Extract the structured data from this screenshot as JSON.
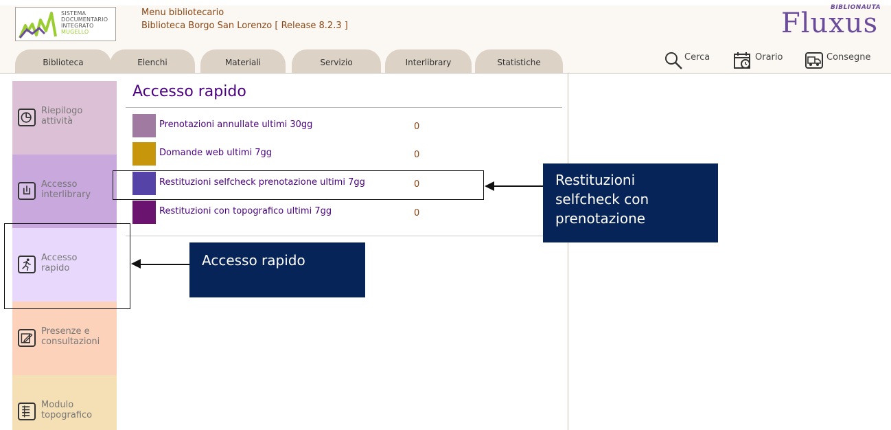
{
  "header": {
    "logo_lines": [
      "Sistema",
      "Documentario",
      "Integrato",
      "Mugello"
    ],
    "menu_title": "Menu bibliotecario",
    "menu_subtitle": "Biblioteca Borgo San Lorenzo [ Release 8.2.3 ]",
    "brand": "Fluxus",
    "brand_tag": "BIBLIONAUTA"
  },
  "tabs": [
    "Biblioteca",
    "Elenchi",
    "Materiali",
    "Servizio",
    "Interlibrary",
    "Statistiche"
  ],
  "tools": {
    "search": {
      "label": "Cerca",
      "icon": "search-icon"
    },
    "schedule": {
      "label": "Orario",
      "icon": "calendar-clock-icon"
    },
    "deliveries": {
      "label": "Consegne",
      "icon": "truck-icon"
    }
  },
  "sidebar": {
    "items": [
      {
        "label1": "Riepilogo",
        "label2": "attività",
        "icon": "pie-chart-icon",
        "color": "#dcc0d5"
      },
      {
        "label1": "Accesso",
        "label2": "interlibrary",
        "icon": "interlibrary-icon",
        "color": "#c9a8de"
      },
      {
        "label1": "Accesso",
        "label2": "rapido",
        "icon": "runner-icon",
        "color": "#e8d8fb"
      },
      {
        "label1": "Presenze e",
        "label2": "consultazioni",
        "icon": "edit-icon",
        "color": "#fcd2ba"
      },
      {
        "label1": "Modulo",
        "label2": "topografico",
        "icon": "document-list-icon",
        "color": "#f5dfb4"
      }
    ]
  },
  "main": {
    "title": "Accesso rapido",
    "rows": [
      {
        "label": "Prenotazioni annullate ultimi 30gg",
        "count": "0",
        "color": "#a07aa0"
      },
      {
        "label": "Domande web ultimi 7gg",
        "count": "0",
        "color": "#c8960a"
      },
      {
        "label": "Restituzioni selfcheck prenotazione ultimi 7gg",
        "count": "0",
        "color": "#5543a8"
      },
      {
        "label": "Restituzioni con topografico ultimi 7gg",
        "count": "0",
        "color": "#6a1470"
      }
    ]
  },
  "annotations": {
    "callout_selfcheck": [
      "Restituzioni",
      "selfcheck con",
      "prenotazione"
    ],
    "callout_rapido": "Accesso rapido"
  }
}
